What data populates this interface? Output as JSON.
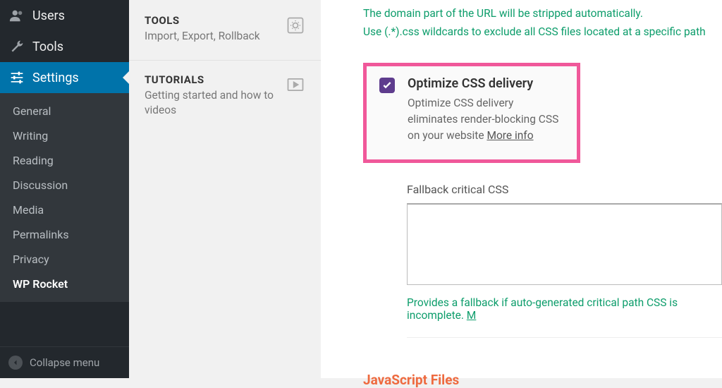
{
  "sidebar": {
    "users": "Users",
    "tools": "Tools",
    "settings": "Settings",
    "submenu": {
      "general": "General",
      "writing": "Writing",
      "reading": "Reading",
      "discussion": "Discussion",
      "media": "Media",
      "permalinks": "Permalinks",
      "privacy": "Privacy",
      "wprocket": "WP Rocket"
    },
    "collapse": "Collapse menu"
  },
  "col2": {
    "tools": {
      "title": "TOOLS",
      "sub": "Import, Export, Rollback"
    },
    "tutorials": {
      "title": "TUTORIALS",
      "sub": "Getting started and how to videos"
    }
  },
  "main": {
    "notice_line1": "The domain part of the URL will be stripped automatically.",
    "notice_line2": "Use (.*).css wildcards to exclude all CSS files located at a specific path",
    "opt": {
      "title": "Optimize CSS delivery",
      "desc_a": "Optimize CSS delivery eliminates render-blocking CSS on your website",
      "more": "More info"
    },
    "fallback_label": "Fallback critical CSS",
    "helper_a": "Provides a fallback if auto-generated critical path CSS is incomplete. ",
    "helper_b": "M",
    "js_title": "JavaScript Files"
  }
}
